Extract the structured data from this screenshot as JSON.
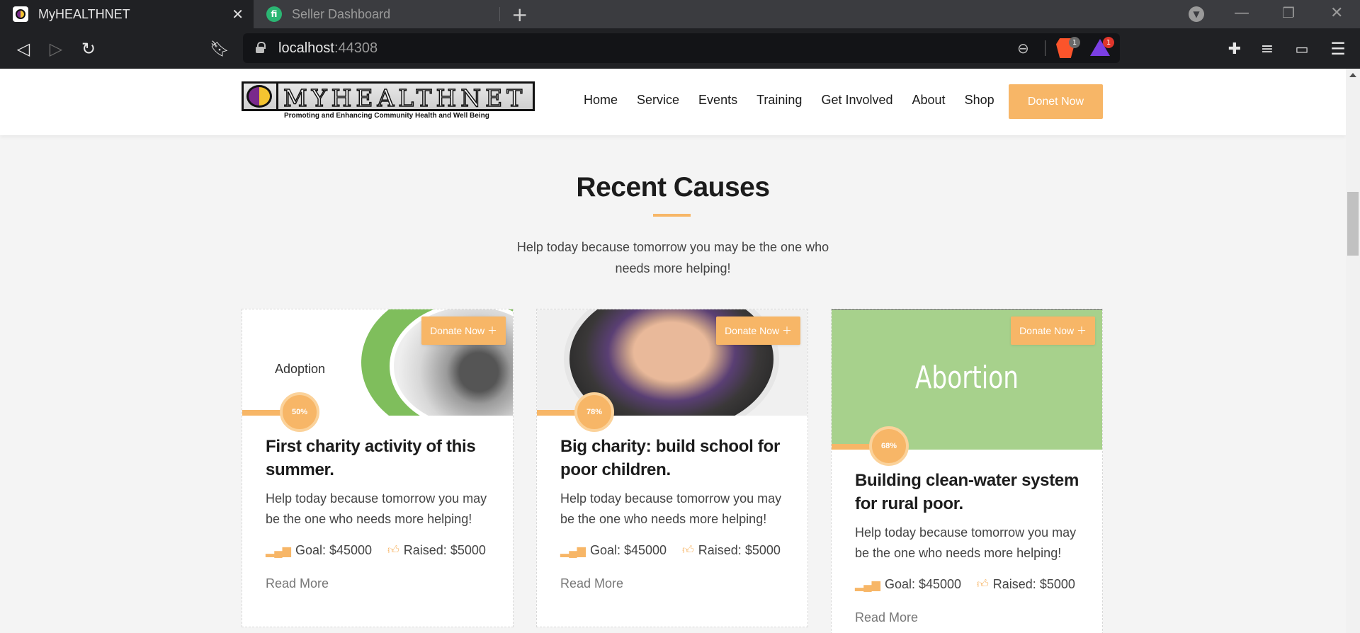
{
  "browser": {
    "tabs": [
      {
        "title": "MyHEALTHNET",
        "active": true
      },
      {
        "title": "Seller Dashboard",
        "active": false
      }
    ],
    "url_host": "localhost",
    "url_port": ":44308",
    "badges": {
      "brave_shields": "1",
      "brave_rewards": "1"
    }
  },
  "header": {
    "logo_text": "MYHEALTHNET",
    "logo_tagline": "Promoting and Enhancing Community Health and Well Being",
    "nav": [
      "Home",
      "Service",
      "Events",
      "Training",
      "Get Involved",
      "About",
      "Shop"
    ],
    "cta_label": "Donet Now"
  },
  "section": {
    "title": "Recent Causes",
    "subtitle": "Help today because tomorrow you may be the one who needs more helping!"
  },
  "cards": [
    {
      "image_text": "Adoption",
      "donate_label": "Donate Now ＋",
      "percent_label": "50%",
      "percent": 50,
      "title": "First charity activity of this summer.",
      "description": "Help today because tomorrow you may be the one who needs more helping!",
      "goal": "Goal: $45000",
      "raised": "Raised: $5000",
      "read_more": "Read More"
    },
    {
      "image_text": "",
      "donate_label": "Donate Now ＋",
      "percent_label": "78%",
      "percent": 78,
      "title": "Big charity: build school for poor children.",
      "description": "Help today because tomorrow you may be the one who needs more helping!",
      "goal": "Goal: $45000",
      "raised": "Raised: $5000",
      "read_more": "Read More"
    },
    {
      "image_text": "Abortion",
      "donate_label": "Donate Now ＋",
      "percent_label": "68%",
      "percent": 68,
      "title": "Building clean-water system for rural poor.",
      "description": "Help today because tomorrow you may be the one who needs more helping!",
      "goal": "Goal: $45000",
      "raised": "Raised: $5000",
      "read_more": "Read More"
    }
  ],
  "colors": {
    "accent": "#f7b667",
    "browser_dark": "#202124",
    "tab_bar": "#3b3c40"
  },
  "icons": {
    "goal": "bar-chart-icon",
    "raised": "thumbs-up-icon"
  }
}
